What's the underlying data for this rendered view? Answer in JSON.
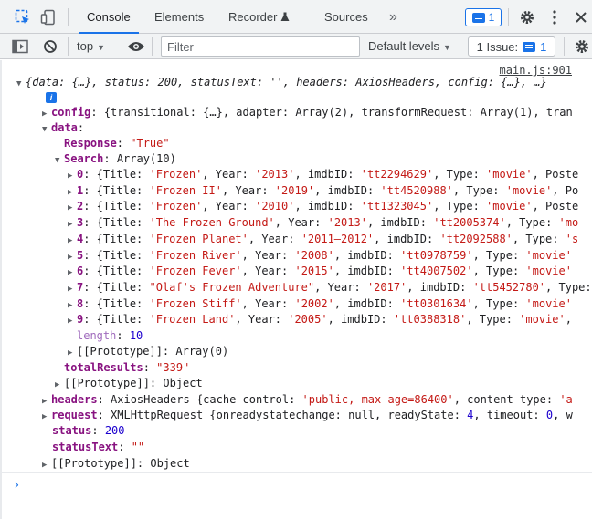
{
  "tabs": [
    {
      "label": "Console",
      "active": true
    },
    {
      "label": "Elements"
    },
    {
      "label": "Recorder"
    },
    {
      "label": "Sources"
    }
  ],
  "more_tabs": "»",
  "issues_count": "1",
  "toolbar": {
    "context": "top",
    "filter_placeholder": "Filter",
    "levels": "Default levels",
    "issue_label": "1 Issue:",
    "issue_count": "1"
  },
  "console": {
    "source_link": "main.js:901",
    "summary": "{data: {…}, status: 200, statusText: '', headers: AxiosHeaders, config: {…}, …}",
    "config_key": "config",
    "config_preview": "{transitional: {…}, adapter: Array(2), transformRequest: Array(1), tran",
    "data_key": "data",
    "response_key": "Response",
    "response_value": "\"True\"",
    "search_key": "Search",
    "search_preview": "Array(10)",
    "search_items": [
      {
        "idx": "0",
        "title": "'Frozen'",
        "year": "'2013'",
        "imdb": "'tt2294629'",
        "type": "'movie'",
        "tail": ", Poste"
      },
      {
        "idx": "1",
        "title": "'Frozen II'",
        "year": "'2019'",
        "imdb": "'tt4520988'",
        "type": "'movie'",
        "tail": ", Po"
      },
      {
        "idx": "2",
        "title": "'Frozen'",
        "year": "'2010'",
        "imdb": "'tt1323045'",
        "type": "'movie'",
        "tail": ", Poste"
      },
      {
        "idx": "3",
        "title": "'The Frozen Ground'",
        "year": "'2013'",
        "imdb": "'tt2005374'",
        "type": "'mo",
        "tail": ""
      },
      {
        "idx": "4",
        "title": "'Frozen Planet'",
        "year": "'2011–2012'",
        "imdb": "'tt2092588'",
        "type": "'s",
        "tail": ""
      },
      {
        "idx": "5",
        "title": "'Frozen River'",
        "year": "'2008'",
        "imdb": "'tt0978759'",
        "type": "'movie'",
        "tail": ""
      },
      {
        "idx": "6",
        "title": "'Frozen Fever'",
        "year": "'2015'",
        "imdb": "'tt4007502'",
        "type": "'movie'",
        "tail": ""
      },
      {
        "idx": "7",
        "title": "\"Olaf's Frozen Adventure\"",
        "year": "'2017'",
        "imdb": "'tt5452780'",
        "type": "",
        "tail": ""
      },
      {
        "idx": "8",
        "title": "'Frozen Stiff'",
        "year": "'2002'",
        "imdb": "'tt0301634'",
        "type": "'movie'",
        "tail": ""
      },
      {
        "idx": "9",
        "title": "'Frozen Land'",
        "year": "'2005'",
        "imdb": "'tt0388318'",
        "type": "'movie'",
        "tail": ","
      }
    ],
    "length_key": "length",
    "length_value": "10",
    "proto_array": "[[Prototype]]: Array(0)",
    "total_key": "totalResults",
    "total_value": "\"339\"",
    "proto_object": "[[Prototype]]: Object",
    "headers_key": "headers",
    "headers_preview_a": "AxiosHeaders {cache-control: ",
    "headers_preview_b": "'public, max-age=86400'",
    "headers_preview_c": ", content-type: ",
    "headers_preview_d": "'a",
    "request_key": "request",
    "request_preview_a": "XMLHttpRequest {onreadystatechange: null, readyState: ",
    "request_preview_b": "4",
    "request_preview_c": ", timeout: ",
    "request_preview_d": "0",
    "request_preview_e": ", w",
    "status_key": "status",
    "status_value": "200",
    "statustext_key": "statusText",
    "statustext_value": "\"\"",
    "proto_root": "[[Prototype]]: Object"
  }
}
